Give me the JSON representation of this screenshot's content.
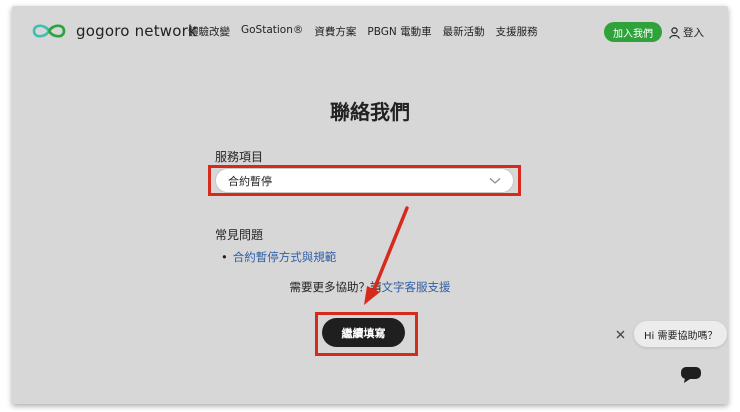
{
  "header": {
    "brand": "gogoro network",
    "nav": [
      "體驗改變",
      "GoStation®",
      "資費方案",
      "PBGN 電動車",
      "最新活動",
      "支援服務"
    ],
    "join_label": "加入我們",
    "login_label": "登入"
  },
  "main": {
    "title": "聯絡我們",
    "service_label": "服務項目",
    "service_selected": "合約暫停",
    "faq_title": "常見問題",
    "faq_items": [
      "合約暫停方式與規範"
    ],
    "help_text": "需要更多協助？請",
    "help_link": "文字客服支援",
    "continue_label": "繼續填寫"
  },
  "chat": {
    "bubble_text": "Hi 需要協助嗎？"
  },
  "colors": {
    "accent": "#2fa23b",
    "highlight": "#d62a1d",
    "link": "#2f5fa8",
    "background": "#d7d7d7"
  }
}
